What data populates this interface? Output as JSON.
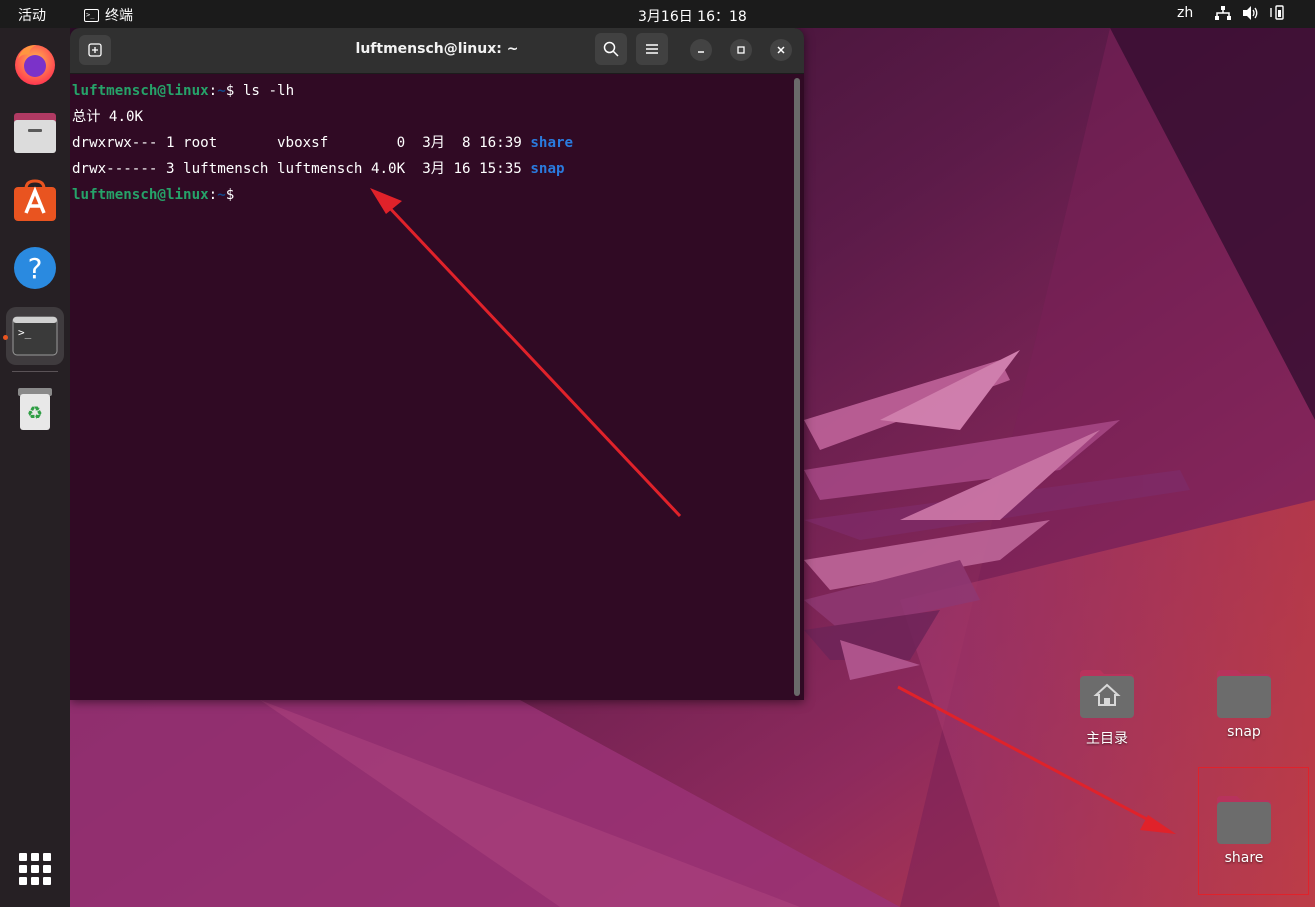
{
  "topbar": {
    "activities": "活动",
    "app_name": "终端",
    "app_icon": "terminal-icon",
    "clock": "3月16日  16：18",
    "language": "zh",
    "tray_icons": [
      "network-icon",
      "volume-icon",
      "power-icon"
    ]
  },
  "dock": {
    "items": [
      {
        "name": "firefox",
        "icon": "firefox-icon"
      },
      {
        "name": "files",
        "icon": "files-icon"
      },
      {
        "name": "ubuntu-software",
        "icon": "software-icon"
      },
      {
        "name": "help",
        "icon": "help-icon"
      },
      {
        "name": "terminal",
        "icon": "terminal-icon",
        "active": true
      },
      {
        "name": "trash",
        "icon": "trash-icon"
      }
    ],
    "app_grid_icon": "grid-icon"
  },
  "terminal": {
    "title": "luftmensch@linux: ~",
    "lines": [
      {
        "user": "luftmensch@linux",
        "sep": ":",
        "path": "~",
        "prompt": "$ ",
        "cmd": "ls -lh"
      },
      {
        "text": "总计 4.0K"
      },
      {
        "text": "drwxrwx--- 1 root       vboxsf        0  3月  8 16:39 ",
        "dir": "share"
      },
      {
        "text": "drwx------ 3 luftmensch luftmensch 4.0K  3月 16 15:35 ",
        "dir": "snap"
      },
      {
        "user": "luftmensch@linux",
        "sep": ":",
        "path": "~",
        "prompt": "$",
        "cmd": ""
      }
    ]
  },
  "desktop": {
    "icons": [
      {
        "label": "主目录",
        "icon": "home-folder-icon"
      },
      {
        "label": "snap",
        "icon": "folder-icon"
      },
      {
        "label": "share",
        "icon": "folder-icon",
        "highlighted": true
      }
    ]
  },
  "colors": {
    "terminal_bg": "#300a24",
    "prompt_user": "#26a269",
    "prompt_path": "#12488b",
    "dir_name": "#2a7bde",
    "annotation": "#e0222a",
    "accent": "#e95420"
  }
}
